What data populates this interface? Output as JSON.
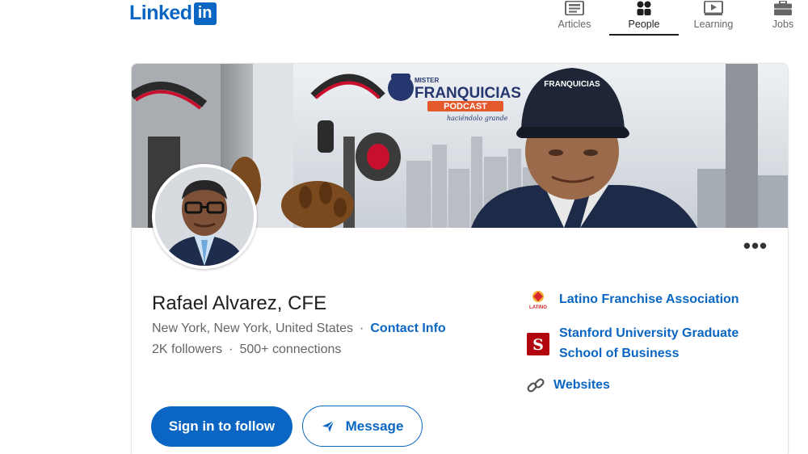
{
  "header": {
    "logo_text": "Linked",
    "logo_box": "in",
    "nav": [
      {
        "label": "Articles",
        "icon": "articles-icon",
        "active": false
      },
      {
        "label": "People",
        "icon": "people-icon",
        "active": true
      },
      {
        "label": "Learning",
        "icon": "learning-icon",
        "active": false
      },
      {
        "label": "Jobs",
        "icon": "jobs-icon",
        "active": false
      }
    ]
  },
  "cover": {
    "brand_small": "MISTER",
    "brand": "FRANQUICIAS",
    "brand_badge": "PODCAST",
    "brand_tagline": "haciéndolo grande",
    "cap_text": "FRANQUICIAS"
  },
  "profile": {
    "name": "Rafael Alvarez, CFE",
    "location": "New York, New York, United States",
    "separator": "·",
    "contact_label": "Contact Info",
    "followers": "2K followers",
    "connections": "500+ connections",
    "more_label": "•••"
  },
  "actions": {
    "follow_label": "Sign in to follow",
    "message_label": "Message"
  },
  "organizations": [
    {
      "name": "Latino Franchise Association",
      "logo_text": "LATINO"
    },
    {
      "name": "Stanford University Graduate School of Business",
      "logo_text": "S"
    }
  ],
  "websites_label": "Websites",
  "colors": {
    "brand_blue": "#0a66c2",
    "text_secondary": "#666666",
    "stanford_red": "#b1040e"
  }
}
